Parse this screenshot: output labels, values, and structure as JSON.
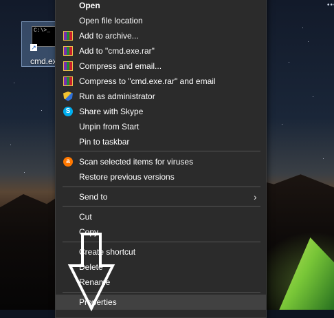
{
  "desktop": {
    "icon_label": "cmd.exe",
    "cmd_prompt": "C:\\>_",
    "top_dots": "•••"
  },
  "context_menu": {
    "items": [
      {
        "label": "Open",
        "icon": null,
        "bold": true
      },
      {
        "label": "Open file location",
        "icon": null
      },
      {
        "label": "Add to archive...",
        "icon": "winrar-icon"
      },
      {
        "label": "Add to \"cmd.exe.rar\"",
        "icon": "winrar-icon"
      },
      {
        "label": "Compress and email...",
        "icon": "winrar-icon"
      },
      {
        "label": "Compress to \"cmd.exe.rar\" and email",
        "icon": "winrar-icon"
      },
      {
        "label": "Run as administrator",
        "icon": "uac-shield-icon"
      },
      {
        "label": "Share with Skype",
        "icon": "skype-icon"
      },
      {
        "label": "Unpin from Start",
        "icon": null
      },
      {
        "label": "Pin to taskbar",
        "icon": null
      },
      {
        "label": "Scan selected items for viruses",
        "icon": "avast-icon"
      },
      {
        "label": "Restore previous versions",
        "icon": null
      },
      {
        "label": "Send to",
        "icon": null,
        "submenu": true
      },
      {
        "label": "Cut",
        "icon": null
      },
      {
        "label": "Copy",
        "icon": null
      },
      {
        "label": "Create shortcut",
        "icon": null
      },
      {
        "label": "Delete",
        "icon": null
      },
      {
        "label": "Rename",
        "icon": null
      },
      {
        "label": "Properties",
        "icon": null,
        "highlighted": true
      }
    ],
    "submenu_glyph": "›"
  },
  "annotation": {
    "icon": "down-arrow-outline-icon"
  }
}
